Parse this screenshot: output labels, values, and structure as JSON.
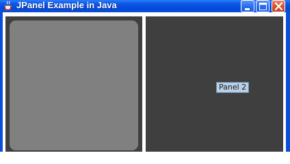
{
  "window": {
    "title": "JPanel Example in Java",
    "icon": "java-cup-icon",
    "controls": {
      "minimize_icon": "minimize-icon",
      "maximize_icon": "maximize-icon",
      "close_icon": "close-icon"
    }
  },
  "panels": {
    "panel1": {
      "label": ""
    },
    "panel2": {
      "label": "Panel 2"
    }
  },
  "colors": {
    "titlebar": "#0b59e8",
    "panel_background": "#3f3f3f",
    "panel1_inner": "#808080",
    "label_background": "#b8cfe5",
    "close_button": "#d9532e"
  }
}
